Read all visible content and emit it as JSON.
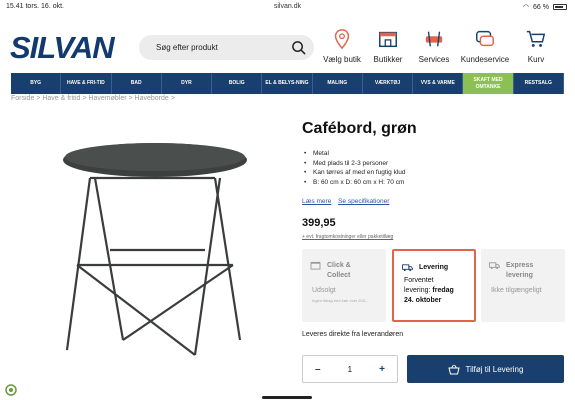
{
  "statusbar": {
    "time": "15.41",
    "date": "tors. 16. okt.",
    "url": "silvan.dk",
    "battery": "66 %"
  },
  "header": {
    "logo": "SILVAN",
    "search_placeholder": "Søg efter produkt",
    "icons": [
      {
        "label": "Vælg butik",
        "icon": "location-pin-icon"
      },
      {
        "label": "Butikker",
        "icon": "store-icon"
      },
      {
        "label": "Services",
        "icon": "tools-icon"
      },
      {
        "label": "Kundeservice",
        "icon": "chat-icon"
      },
      {
        "label": "Kurv",
        "icon": "cart-icon"
      }
    ]
  },
  "nav": [
    "BYG",
    "HAVE & FRI-TID",
    "BAD",
    "DYR",
    "BOLIG",
    "EL & BELYS-NING",
    "MALING",
    "VÆRKTØJ",
    "VVS & VARME",
    "SKAFT MED OMTANKE",
    "RESTSALG"
  ],
  "breadcrumb": "Forside  >  Have & fritid  >  Havemøbler  >  Haveborde  >",
  "product": {
    "title": "Cafébord, grøn",
    "bullets": [
      "Metal",
      "Med plads til 2-3 personer",
      "Kan tørres af med en fugtig klud",
      "B: 60 cm x D: 60 cm x H: 70 cm"
    ],
    "read_more": "Læs mere",
    "specs": "Se specifikationer",
    "price": "399,95",
    "freight": "+ evt. fragtomkostninger eller pakketillæg"
  },
  "options": {
    "click_collect": {
      "title1": "Click &",
      "title2": "Collect",
      "status": "Udsolgt",
      "note": "Ingen tilbag end køb over 200,-"
    },
    "delivery": {
      "title": "Levering",
      "line1": "Forventet",
      "line2_prefix": "levering: ",
      "line2_bold": "fredag",
      "line3": "24. oktober"
    },
    "express": {
      "title1": "Express",
      "title2": "levering",
      "status": "Ikke tilgængeligt"
    }
  },
  "supplier_note": "Leveres direkte fra leverandøren",
  "quantity": {
    "minus": "–",
    "value": "1",
    "plus": "+"
  },
  "add_to_cart": "Tilføj til Levering",
  "colors": {
    "brand": "#183f6d",
    "accent": "#e0654c",
    "green": "#8cc054"
  }
}
